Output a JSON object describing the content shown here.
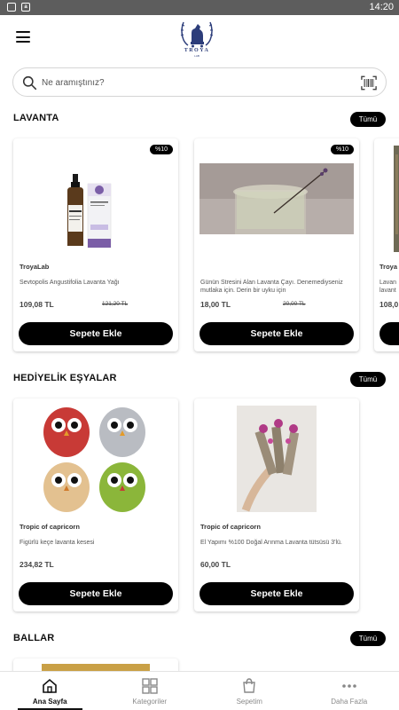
{
  "status_bar": {
    "time": "14:20",
    "icon_1": "notification-icon",
    "icon_2": "a",
    "icon_2_name": "app-icon"
  },
  "header": {
    "logo_text": "TROYA",
    "logo_sub": "LAB",
    "menu_icon": "hamburger-menu-icon"
  },
  "search": {
    "placeholder": "Ne aramıştınız?",
    "search_icon": "search-icon",
    "barcode_icon": "barcode-scan-icon"
  },
  "sections": [
    {
      "title": "LAVANTA",
      "all_label": "Tümü",
      "products": [
        {
          "badge": "%10",
          "brand": "TroyaLab",
          "name": "Sevtopolis Angustifolia Lavanta Yağı",
          "price": "109,08 TL",
          "old_price": "121,20 TL",
          "button": "Sepete Ekle"
        },
        {
          "badge": "%10",
          "brand": "",
          "name": "Günün Stresini Alan Lavanta Çayı. Denemediyseniz mutlaka için. Derin bir uyku için",
          "price": "18,00 TL",
          "old_price": "20,00 TL",
          "button": "Sepete Ekle"
        },
        {
          "brand": "Troya",
          "name": "Lavan lavant",
          "price": "108,0"
        }
      ]
    },
    {
      "title": "HEDİYELİK EŞYALAR",
      "all_label": "Tümü",
      "products": [
        {
          "brand": "Tropic of capricorn",
          "name": "Figürlü keçe lavanta kesesi",
          "price": "234,82 TL",
          "button": "Sepete Ekle"
        },
        {
          "brand": "Tropic of capricorn",
          "name": "El Yapımı %100 Doğal Arınma Lavanta tütsüsü 3'lü.",
          "price": "60,00 TL",
          "button": "Sepete Ekle"
        }
      ]
    },
    {
      "title": "BALLAR",
      "all_label": "Tümü"
    }
  ],
  "bottom_nav": [
    {
      "label": "Ana Sayfa",
      "icon": "home-icon",
      "active": true
    },
    {
      "label": "Kategoriler",
      "icon": "grid-icon",
      "active": false
    },
    {
      "label": "Sepetim",
      "icon": "cart-icon",
      "active": false
    },
    {
      "label": "Daha Fazla",
      "icon": "more-dots-icon",
      "active": false
    }
  ],
  "colors": {
    "accent": "#000000",
    "brand_blue": "#2c3d7a",
    "lavender": "#7b5ea7"
  }
}
